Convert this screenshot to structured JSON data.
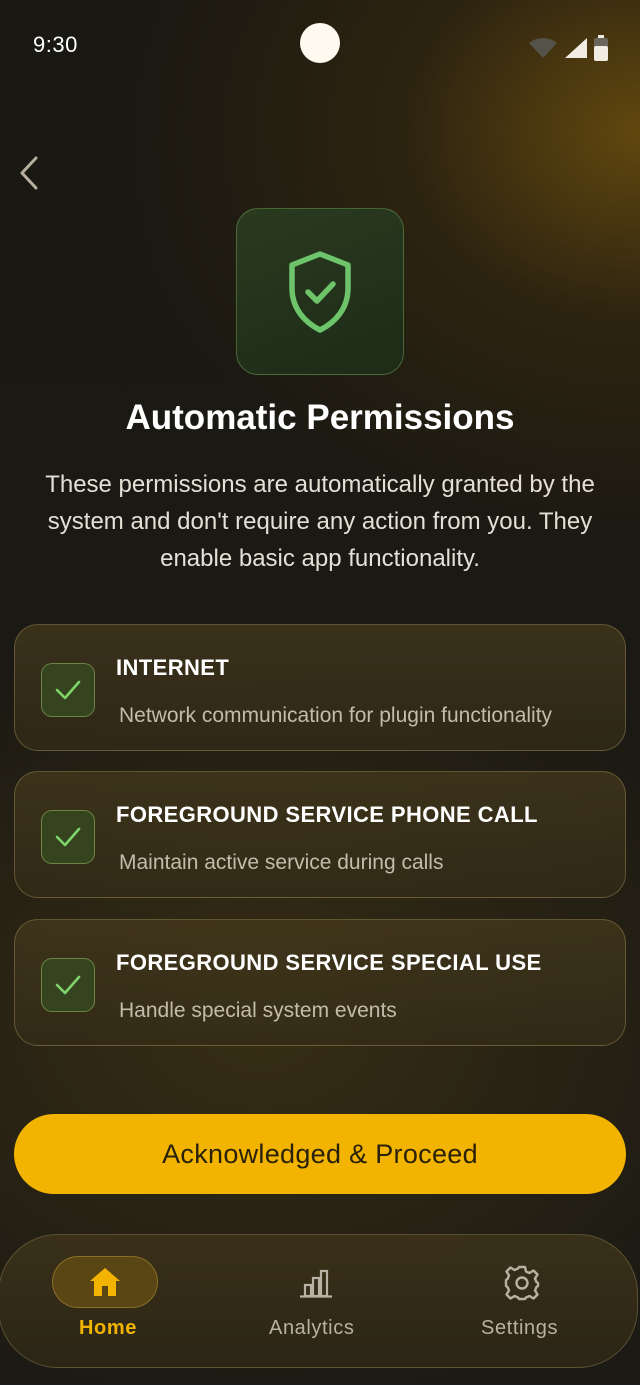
{
  "status_bar": {
    "time": "9:30"
  },
  "header": {
    "back_icon": "chevron-left-icon"
  },
  "hero": {
    "icon": "shield-check-icon"
  },
  "title": "Automatic Permissions",
  "description": "These permissions are automatically granted by the system and don't require any action from you. They enable basic app functionality.",
  "permissions": [
    {
      "name": "INTERNET",
      "description": "Network communication for plugin functionality",
      "checked": true
    },
    {
      "name": "FOREGROUND SERVICE PHONE CALL",
      "description": "Maintain active service during calls",
      "checked": true
    },
    {
      "name": "FOREGROUND SERVICE SPECIAL USE",
      "description": "Handle special system events",
      "checked": true
    }
  ],
  "primary_button": {
    "label": "Acknowledged & Proceed"
  },
  "bottom_nav": {
    "items": [
      {
        "label": "Home",
        "icon": "home-icon",
        "active": true
      },
      {
        "label": "Analytics",
        "icon": "bar-chart-icon",
        "active": false
      },
      {
        "label": "Settings",
        "icon": "gear-icon",
        "active": false
      }
    ]
  },
  "colors": {
    "accent": "#f2b400",
    "success": "#7fd46a",
    "background": "#1a1812"
  }
}
